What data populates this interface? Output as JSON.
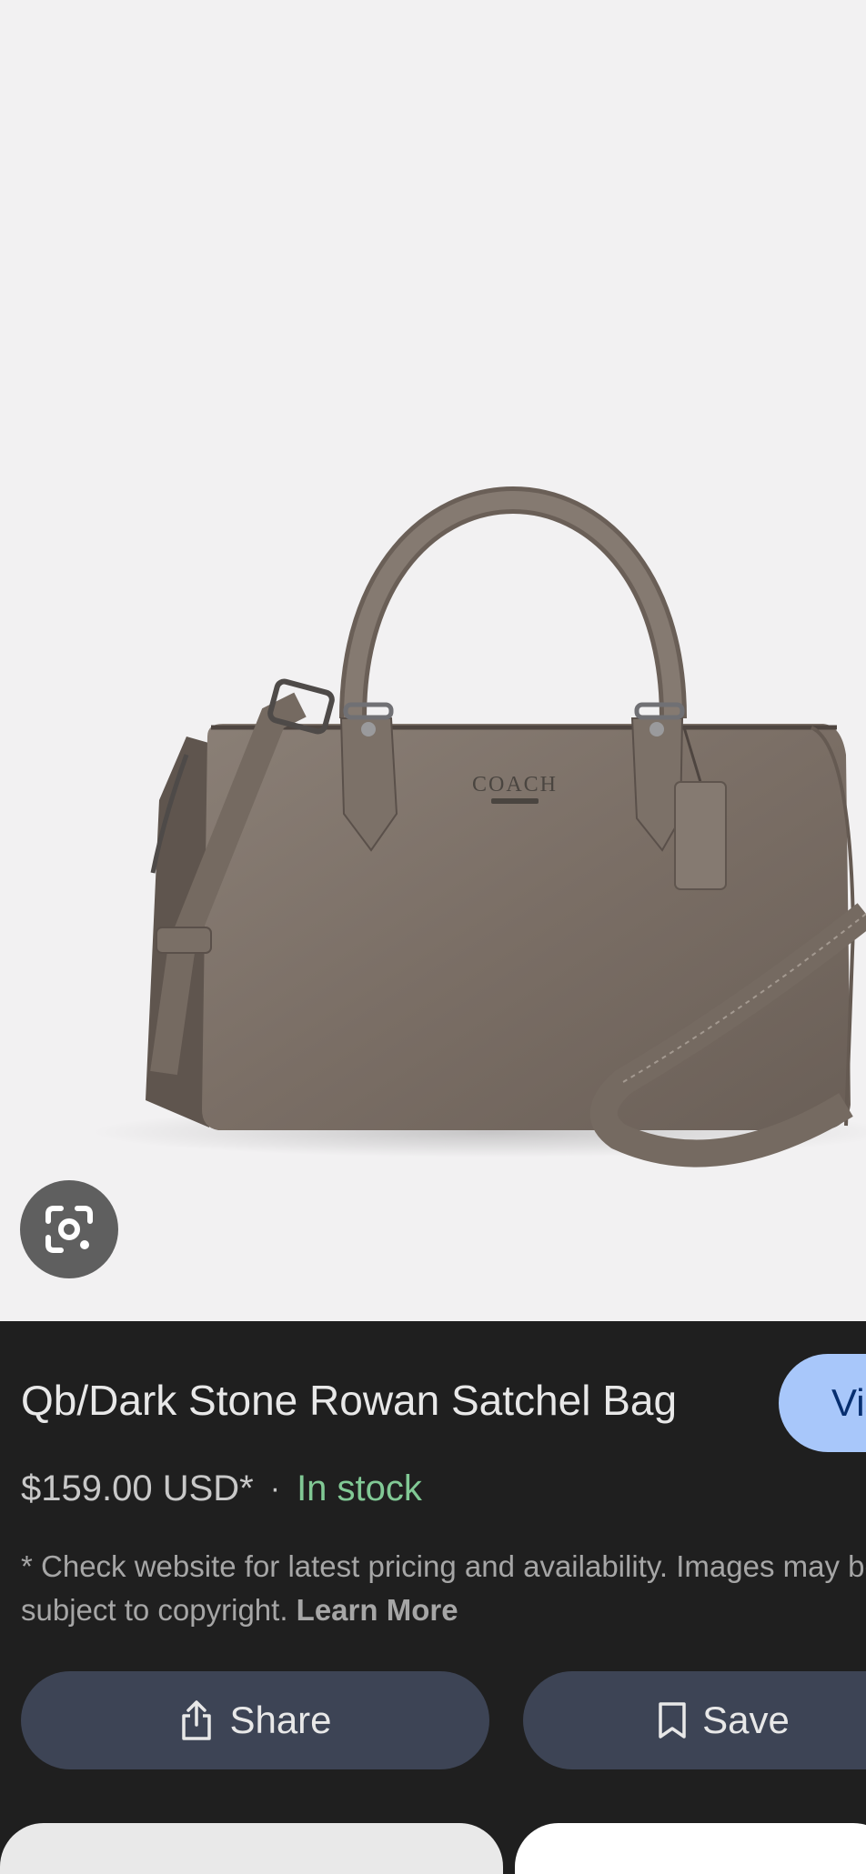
{
  "product": {
    "title": "Qb/Dark Stone Rowan Satchel Bag",
    "price": "$159.00 USD*",
    "separator": "·",
    "stock_status": "In stock",
    "disclaimer_line1": "* Check website for latest pricing and availability. Images may be",
    "disclaimer_line2": "subject to copyright.",
    "learn_more": "Learn More",
    "logo_text": "COACH"
  },
  "actions": {
    "visit_label": "Visit",
    "share_label": "Share",
    "save_label": "Save"
  },
  "icons": {
    "lens": "google-lens-icon",
    "share": "share-icon",
    "save": "bookmark-icon"
  },
  "colors": {
    "panel_background": "#1f1f1f",
    "image_background": "#f2f1f2",
    "visit_button": "#a8c7fa",
    "action_button": "#3d4455",
    "in_stock": "#81c995",
    "bag": "#786d64"
  }
}
